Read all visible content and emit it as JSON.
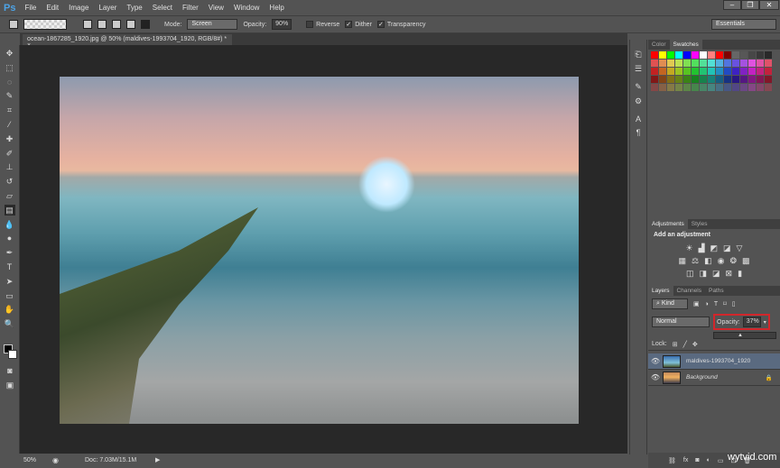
{
  "app": {
    "logo": "Ps",
    "menu": [
      "File",
      "Edit",
      "Image",
      "Layer",
      "Type",
      "Select",
      "Filter",
      "View",
      "Window",
      "Help"
    ],
    "window_buttons": [
      "–",
      "❐",
      "✕"
    ]
  },
  "options": {
    "mode_label": "Mode:",
    "mode_value": "Screen",
    "opacity_label": "Opacity:",
    "opacity_value": "90%",
    "reverse_label": "Reverse",
    "dither_label": "Dither",
    "transparency_label": "Transparency",
    "workspace": "Essentials",
    "dither_checked": true,
    "transparency_checked": true,
    "reverse_checked": false
  },
  "document": {
    "tab_title": "ocean-1867285_1920.jpg @ 50% (maldives-1993704_1920, RGB/8#) *",
    "close": "×"
  },
  "status": {
    "zoom": "50%",
    "doc": "Doc: 7.03M/15.1M"
  },
  "color_panel": {
    "tabs": [
      "Color",
      "Swatches"
    ],
    "active": "Swatches"
  },
  "adjustments": {
    "tabs": [
      "Adjustments",
      "Styles"
    ],
    "heading": "Add an adjustment"
  },
  "layers_panel": {
    "tabs": [
      "Layers",
      "Channels",
      "Paths"
    ],
    "kind": "Kind",
    "blend_mode": "Normal",
    "opacity_label": "Opacity:",
    "opacity_value": "37%",
    "lock_label": "Lock:",
    "layers": [
      {
        "name": "maldives-1993704_1920",
        "selected": true
      },
      {
        "name": "Background",
        "locked": true
      }
    ]
  },
  "watermark": "wytvid.com",
  "colors": {
    "accent": "#4da3e6",
    "highlight": "#d2262b",
    "selected_layer": "#5a6a80"
  }
}
